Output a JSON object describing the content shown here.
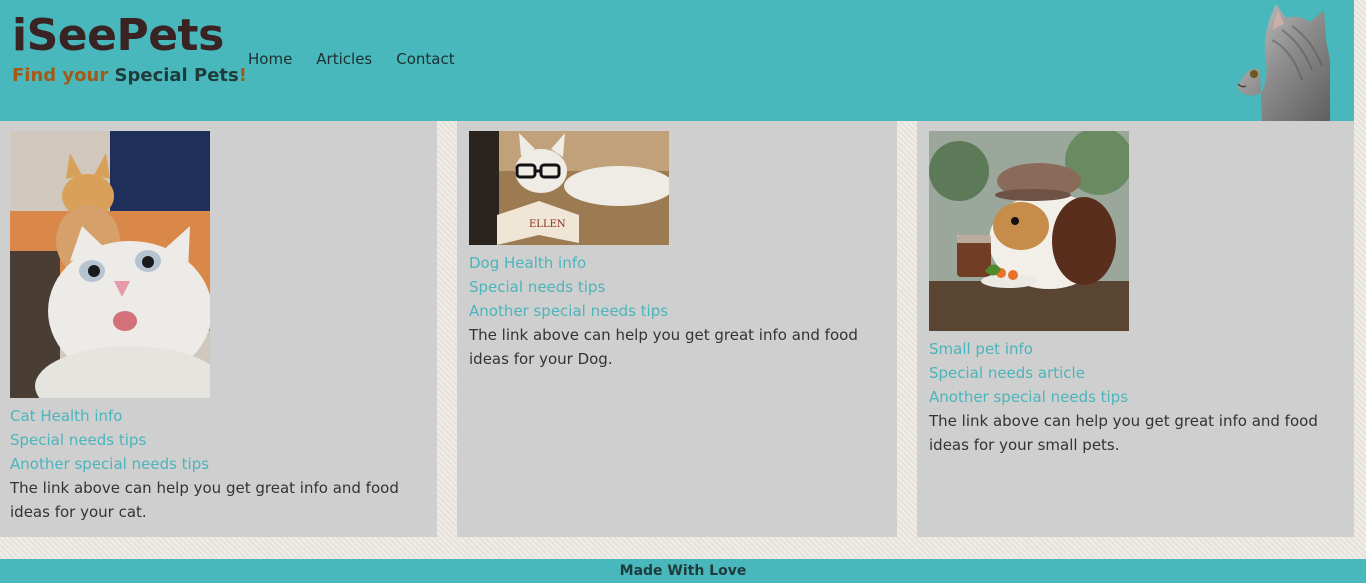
{
  "header": {
    "title": "iSeePets",
    "tagline_part1": "Find your",
    "tagline_part2": "Special Pets",
    "tagline_part3": "!",
    "nav": [
      "Home",
      "Articles",
      "Contact"
    ],
    "decor_icon": "cat-profile-icon",
    "bg_color": "#48b8bc"
  },
  "cards": [
    {
      "image_icon": "cat-selfie-icon",
      "links": [
        "Cat Health info",
        "Special needs tips",
        "Another special needs tips"
      ],
      "text": "The link above can help you get great info and food ideas for your cat."
    },
    {
      "image_icon": "dog-reading-icon",
      "links": [
        "Dog Health info",
        "Special needs tips",
        "Another special needs tips"
      ],
      "text": "The link above can help you get great info and food ideas for your Dog."
    },
    {
      "image_icon": "guinea-pig-hat-icon",
      "links": [
        "Small pet info",
        "Special needs article",
        "Another special needs tips"
      ],
      "text": "The link above can help you get great info and food ideas for your small pets."
    }
  ],
  "footer": {
    "text": "Made With Love"
  }
}
